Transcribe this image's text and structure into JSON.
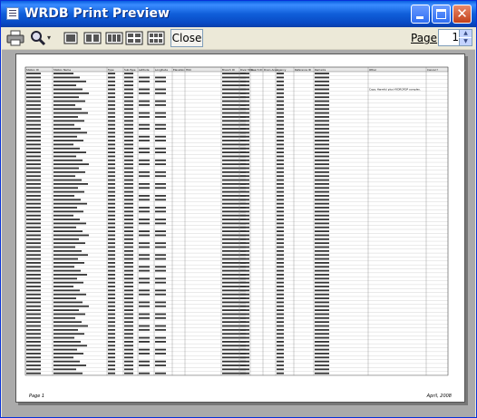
{
  "window": {
    "title": "WRDB Print Preview"
  },
  "toolbar": {
    "close_label": "Close",
    "page_label": "Page",
    "page_value": "1",
    "zoom_dropdown": "▾"
  },
  "icons": {
    "print": "printer-icon",
    "zoom": "magnifier-icon",
    "one_page": "one-page-icon",
    "two_pages": "two-pages-icon",
    "three_pages": "three-pages-icon",
    "four_pages": "four-pages-icon",
    "six_pages": "six-pages-icon"
  },
  "report": {
    "columns": [
      "Station ID",
      "Station Name",
      "Type",
      "Sub-Type",
      "Latitude",
      "Longitude",
      "Elevation",
      "HUC",
      "Branch ID",
      "River Mile",
      "Reach ID",
      "Drain Area",
      "Agency",
      "Reference ID",
      "Remarks",
      "Other",
      "Cancel ?"
    ],
    "highlight_note": "Copy: Harmful plus HYDROFOP complex.",
    "footer_left": "Page 1",
    "footer_right": "April, 2008"
  }
}
